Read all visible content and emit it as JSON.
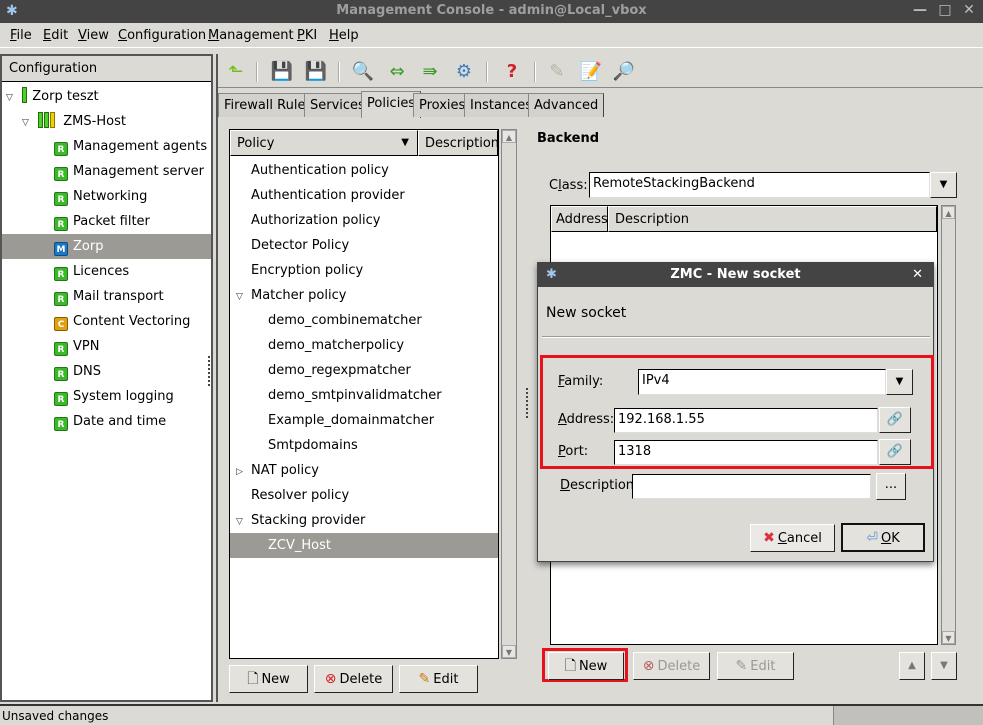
{
  "window": {
    "title": "Management Console - admin@Local_vbox",
    "app_icon": "zorp-figure-icon",
    "controls": [
      "minimize",
      "maximize",
      "close"
    ]
  },
  "menubar": [
    {
      "label": "File",
      "mnemonic": "F"
    },
    {
      "label": "Edit",
      "mnemonic": "E"
    },
    {
      "label": "View",
      "mnemonic": "V"
    },
    {
      "label": "Configuration",
      "mnemonic": "C"
    },
    {
      "label": "Management",
      "mnemonic": "M"
    },
    {
      "label": "PKI",
      "mnemonic": "P"
    },
    {
      "label": "Help",
      "mnemonic": "H"
    }
  ],
  "sidebar": {
    "header": "Configuration",
    "root": {
      "label": "Zorp teszt",
      "expanded": true
    },
    "host": {
      "label": "ZMS-Host",
      "expanded": true
    },
    "items": [
      {
        "label": "Management agents",
        "badge": "R",
        "selected": false
      },
      {
        "label": "Management server",
        "badge": "R",
        "selected": false
      },
      {
        "label": "Networking",
        "badge": "R",
        "selected": false
      },
      {
        "label": "Packet filter",
        "badge": "R",
        "selected": false
      },
      {
        "label": "Zorp",
        "badge": "M",
        "selected": true
      },
      {
        "label": "Licences",
        "badge": "R",
        "selected": false
      },
      {
        "label": "Mail transport",
        "badge": "R",
        "selected": false
      },
      {
        "label": "Content Vectoring",
        "badge": "C",
        "selected": false
      },
      {
        "label": "VPN",
        "badge": "R",
        "selected": false
      },
      {
        "label": "DNS",
        "badge": "R",
        "selected": false
      },
      {
        "label": "System logging",
        "badge": "R",
        "selected": false
      },
      {
        "label": "Date and time",
        "badge": "R",
        "selected": false
      }
    ]
  },
  "toolbar": {
    "icons": [
      "up-arrow-icon",
      "save-commit-icon",
      "save-revert-icon",
      "search-icon",
      "compare-icon",
      "upload-config-icon",
      "gear-icon",
      "save-help-icon",
      "edit-cloud-icon",
      "edit-document-icon",
      "inspect-icon"
    ]
  },
  "tabs": [
    {
      "label": "Firewall Rules",
      "active": false
    },
    {
      "label": "Services",
      "active": false
    },
    {
      "label": "Policies",
      "active": true
    },
    {
      "label": "Proxies",
      "active": false
    },
    {
      "label": "Instances",
      "active": false
    },
    {
      "label": "Advanced",
      "active": false
    }
  ],
  "policies": {
    "columns": [
      "Policy",
      "Description"
    ],
    "rows": [
      {
        "label": "Authentication policy",
        "level": 0,
        "toggle": ""
      },
      {
        "label": "Authentication provider",
        "level": 0,
        "toggle": ""
      },
      {
        "label": "Authorization policy",
        "level": 0,
        "toggle": ""
      },
      {
        "label": "Detector Policy",
        "level": 0,
        "toggle": ""
      },
      {
        "label": "Encryption policy",
        "level": 0,
        "toggle": ""
      },
      {
        "label": "Matcher policy",
        "level": 0,
        "toggle": "expanded"
      },
      {
        "label": "demo_combinematcher",
        "level": 1,
        "toggle": ""
      },
      {
        "label": "demo_matcherpolicy",
        "level": 1,
        "toggle": ""
      },
      {
        "label": "demo_regexpmatcher",
        "level": 1,
        "toggle": ""
      },
      {
        "label": "demo_smtpinvalidmatcher",
        "level": 1,
        "toggle": ""
      },
      {
        "label": "Example_domainmatcher",
        "level": 1,
        "toggle": ""
      },
      {
        "label": "Smtpdomains",
        "level": 1,
        "toggle": ""
      },
      {
        "label": "NAT policy",
        "level": 0,
        "toggle": "collapsed"
      },
      {
        "label": "Resolver policy",
        "level": 0,
        "toggle": ""
      },
      {
        "label": "Stacking provider",
        "level": 0,
        "toggle": "expanded"
      },
      {
        "label": "ZCV_Host",
        "level": 1,
        "toggle": "",
        "selected": true
      }
    ],
    "buttons": {
      "new": "New",
      "delete": "Delete",
      "edit": "Edit"
    }
  },
  "backend": {
    "heading": "Backend",
    "class_label": "Class:",
    "class_value": "RemoteStackingBackend",
    "columns": [
      "Address",
      "Description"
    ],
    "buttons": {
      "new": "New",
      "delete": "Delete",
      "edit": "Edit"
    }
  },
  "dialog": {
    "title": "ZMC - New socket",
    "heading": "New socket",
    "family_label": "Family:",
    "family_value": "IPv4",
    "address_label": "Address:",
    "address_value": "192.168.1.55",
    "port_label": "Port:",
    "port_value": "1318",
    "description_label": "Description:",
    "description_value": "",
    "ellipsis": "...",
    "cancel": "Cancel",
    "ok": "OK"
  },
  "highlight_color": "#e8121c",
  "statusbar": {
    "text": "Unsaved changes"
  }
}
